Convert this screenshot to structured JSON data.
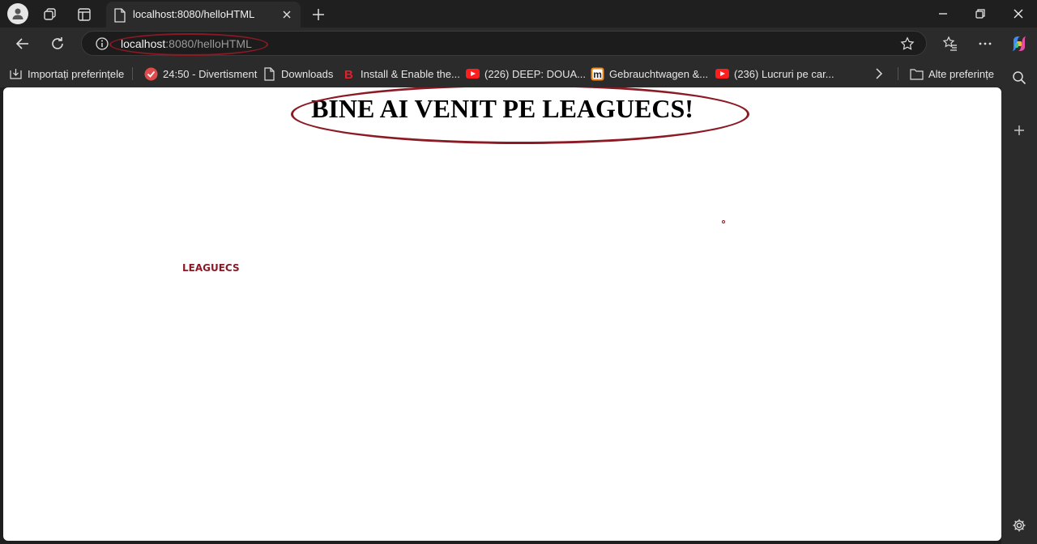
{
  "tab": {
    "title": "localhost:8080/helloHTML",
    "close_label": "×"
  },
  "new_tab_label": "+",
  "address": {
    "host": "localhost",
    "path": ":8080/helloHTML"
  },
  "favorites": [
    {
      "label": "Importați preferințele",
      "icon": "import-icon"
    },
    {
      "label": "24:50 - Divertisment",
      "icon": "red-check-icon"
    },
    {
      "label": "Downloads",
      "icon": "page-icon"
    },
    {
      "label": "Install & Enable the...",
      "icon": "b-logo-icon"
    },
    {
      "label": "(226) DEEP: DOUA...",
      "icon": "youtube-icon"
    },
    {
      "label": "Gebrauchtwagen &...",
      "icon": "m-logo-icon"
    },
    {
      "label": "(236) Lucruri pe car...",
      "icon": "youtube-icon"
    },
    {
      "label": "Alte preferințe",
      "icon": "folder-icon"
    }
  ],
  "page": {
    "headline": "BINE AI VENIT PE LEAGUECS!",
    "brand": "LEAGUECS"
  },
  "colors": {
    "accent": "#8b1a24",
    "chrome_bg": "#1f1f1f",
    "toolbar_bg": "#2b2b2b"
  }
}
